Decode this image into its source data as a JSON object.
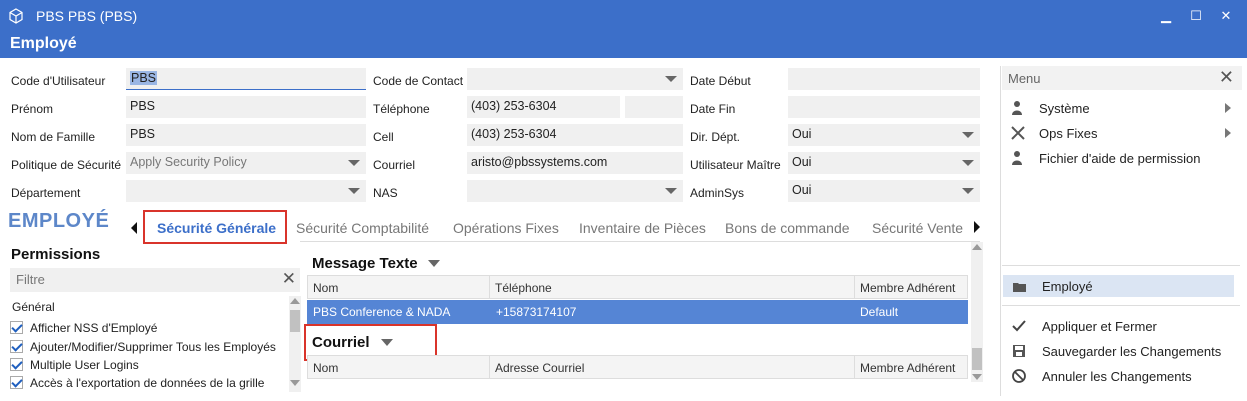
{
  "window": {
    "title": "PBS PBS (PBS)",
    "subtitle": "Employé"
  },
  "form": {
    "col1": [
      {
        "label": "Code d'Utilisateur",
        "value": "PBS"
      },
      {
        "label": "Prénom",
        "value": "PBS"
      },
      {
        "label": "Nom de Famille",
        "value": "PBS"
      },
      {
        "label": "Politique de Sécurité",
        "value": "Apply Security Policy"
      },
      {
        "label": "Département",
        "value": ""
      }
    ],
    "col2": [
      {
        "label": "Code de Contact",
        "value": ""
      },
      {
        "label": "Téléphone",
        "value": "(403) 253-6304"
      },
      {
        "label": "Cell",
        "value": "(403) 253-6304"
      },
      {
        "label": "Courriel",
        "value": "aristo@pbssystems.com"
      },
      {
        "label": "NAS",
        "value": ""
      }
    ],
    "col3": [
      {
        "label": "Date Début",
        "value": ""
      },
      {
        "label": "Date Fin",
        "value": ""
      },
      {
        "label": "Dir. Dépt.",
        "value": "Oui"
      },
      {
        "label": "Utilisateur Maître",
        "value": "Oui"
      },
      {
        "label": "AdminSys",
        "value": "Oui"
      }
    ]
  },
  "section_title": "EMPLOYÉ",
  "tabs": [
    "Sécurité Générale",
    "Sécurité Comptabilité",
    "Opérations Fixes",
    "Inventaire de Pièces",
    "Bons de commande",
    "Sécurité Vente"
  ],
  "permissions": {
    "title": "Permissions",
    "filter_placeholder": "Filtre",
    "group": "Général",
    "items": [
      "Afficher NSS d'Employé",
      "Ajouter/Modifier/Supprimer Tous les Employés",
      "Multiple User Logins",
      "Accès à l'exportation de données de la grille"
    ]
  },
  "message_texte": {
    "title": "Message Texte",
    "columns": [
      "Nom",
      "Téléphone",
      "Membre Adhérent"
    ],
    "rows": [
      [
        "PBS Conference & NADA",
        "+15873174107",
        "Default"
      ]
    ]
  },
  "courriel": {
    "title": "Courriel",
    "columns": [
      "Nom",
      "Adresse Courriel",
      "Membre Adhérent"
    ]
  },
  "menu": {
    "title": "Menu",
    "items": [
      "Système",
      "Ops Fixes",
      "Fichier d'aide de permission"
    ],
    "selected": "Employé",
    "actions": [
      "Appliquer et Fermer",
      "Sauvegarder les Changements",
      "Annuler les Changements"
    ]
  },
  "colors": {
    "accent": "#3c6fc9",
    "highlight": "#d9342b",
    "row_selected": "#5585d5"
  }
}
